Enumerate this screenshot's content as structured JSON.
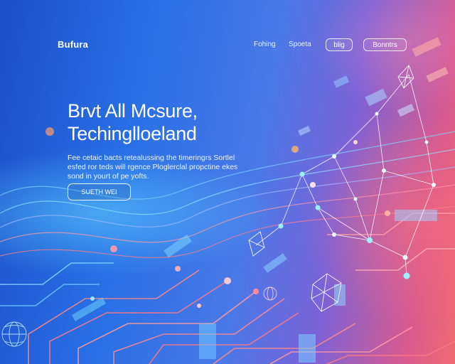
{
  "brand": {
    "logo_text": "Bufura"
  },
  "nav": {
    "links": [
      {
        "label": "Fohing"
      },
      {
        "label": "Spoeta"
      }
    ],
    "pills": [
      {
        "label": "blig"
      },
      {
        "label": "Bonntrs"
      }
    ]
  },
  "hero": {
    "title_line1": "Brvt All Mcsure,",
    "title_line2": "Techinglloeland",
    "description": "Fee cetaic bacts retealussing the timeringrs Sortlel esfed ror teds will rgence Ploglerclal propctine ekes sond in yourt of pe yofts.",
    "cta_label": "SUETH WEI"
  },
  "colors": {
    "bg_left": "#1d4fc9",
    "bg_mid": "#4a79e8",
    "bg_right": "#ef6a72",
    "accent_cyan": "#5ad2ff",
    "accent_coral": "#ff6f7a"
  },
  "decor": {
    "network_icon": "network-graph-icon",
    "gem_icon": "polyhedron-icon",
    "globe_icon": "globe-icon"
  }
}
